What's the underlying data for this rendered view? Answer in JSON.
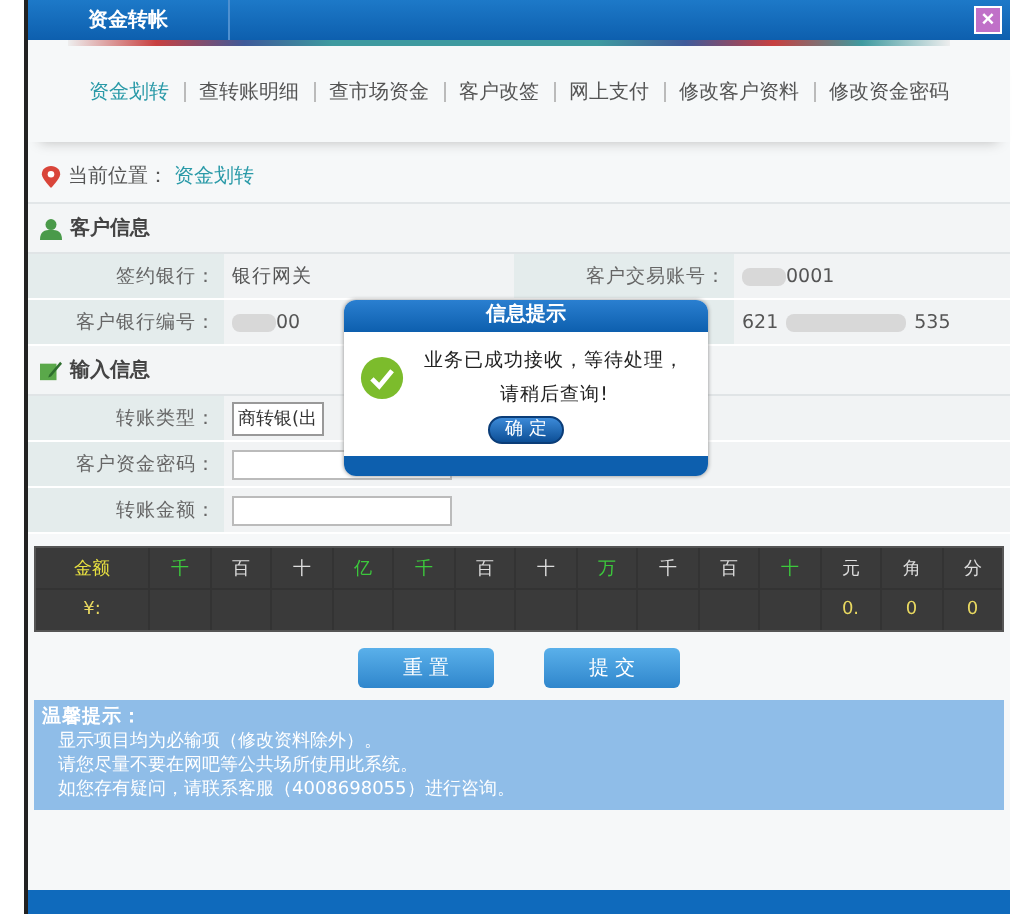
{
  "window": {
    "tab": "资金转帐",
    "close": "×"
  },
  "nav": [
    {
      "label": "资金划转",
      "selected": true
    },
    {
      "label": "查转账明细",
      "selected": false
    },
    {
      "label": "查市场资金",
      "selected": false
    },
    {
      "label": "客户改签",
      "selected": false
    },
    {
      "label": "网上支付",
      "selected": false
    },
    {
      "label": "修改客户资料",
      "selected": false
    },
    {
      "label": "修改资金密码",
      "selected": false
    }
  ],
  "breadcrumb": {
    "label": "当前位置：",
    "current": "资金划转"
  },
  "customer_info": {
    "title": "客户信息",
    "rows": [
      {
        "label_1": "签约银行：",
        "value_1": "银行网关",
        "masked_1": false,
        "label_2": "客户交易账号：",
        "value_2": "0001",
        "masked_2": true
      },
      {
        "label_1": "客户银行编号：",
        "value_1": "00",
        "masked_1": true,
        "value_2": "621",
        "suffix_2": "535",
        "masked_2": true
      }
    ]
  },
  "input_info": {
    "title": "输入信息",
    "rows": [
      {
        "label": "转账类型：",
        "kind": "select",
        "value": "商转银(出"
      },
      {
        "label": "客户资金密码：",
        "kind": "input"
      },
      {
        "label": "转账金额：",
        "kind": "input"
      }
    ]
  },
  "amount_table": {
    "header": [
      {
        "text": "金额",
        "color": "#e8e040"
      },
      {
        "text": "千",
        "color": "#3cc83c"
      },
      {
        "text": "百",
        "color": "#dddddd"
      },
      {
        "text": "十",
        "color": "#dddddd"
      },
      {
        "text": "亿",
        "color": "#3cc83c"
      },
      {
        "text": "千",
        "color": "#3cc83c"
      },
      {
        "text": "百",
        "color": "#dddddd"
      },
      {
        "text": "十",
        "color": "#dddddd"
      },
      {
        "text": "万",
        "color": "#3cc83c"
      },
      {
        "text": "千",
        "color": "#dddddd"
      },
      {
        "text": "百",
        "color": "#dddddd"
      },
      {
        "text": "十",
        "color": "#3cc83c"
      },
      {
        "text": "元",
        "color": "#dddddd"
      },
      {
        "text": "角",
        "color": "#dddddd"
      },
      {
        "text": "分",
        "color": "#dddddd"
      }
    ],
    "currency": "¥:",
    "trailing_values": [
      "0.",
      "0",
      "0"
    ]
  },
  "buttons": [
    "重 置",
    "提 交"
  ],
  "tips": {
    "title": "温馨提示：",
    "lines": [
      "显示项目均为必输项（修改资料除外）。",
      "请您尽量不要在网吧等公共场所使用此系统。",
      "如您存有疑问，请联系客服（4008698055）进行咨询。"
    ]
  },
  "dialog": {
    "title": "信息提示",
    "message": "业务已成功接收，等待处理，请稍后查询!",
    "button": "确 定"
  }
}
